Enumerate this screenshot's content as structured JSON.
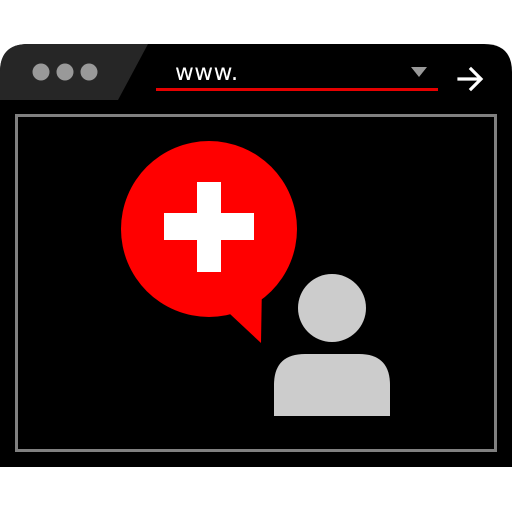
{
  "browser": {
    "address_bar": {
      "value": "www.",
      "dropdown_icon": "triangle-down-icon",
      "accent_color": "#e60000"
    },
    "go_icon": "arrow-right-icon",
    "window_dots": 3
  },
  "content": {
    "badge_icon": "medical-cross-icon",
    "badge_color": "#ff0000",
    "person_icon": "user-icon",
    "person_color": "#cccccc"
  },
  "colors": {
    "window": "#000000",
    "titlebar": "#262626",
    "dots": "#999999",
    "frame": "#808080"
  }
}
